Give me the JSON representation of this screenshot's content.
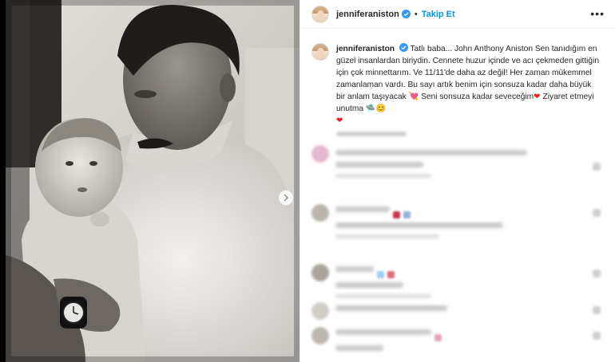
{
  "post": {
    "username": "jenniferaniston",
    "follow_label": "Takip Et",
    "separator": "•",
    "more_label": "•••",
    "caption": {
      "username": "jenniferaniston",
      "text_1": "Tatlı baba... John Anthony Aniston Sen tanıdığım en güzel insanlardan biriydin. Cennete huzur içinde ve acı çekmeden gittiğin için çok minnettarım. Ve 11/11'de daha az değil! Her zaman mükemmel zamanlaman vardı. Bu sayı artık benim için sonsuza kadar daha büyük bir anlam taşıyacak ",
      "emoji_1": "💘",
      "text_2": " Seni sonsuza kadar seveceğim",
      "emoji_2": "❤",
      "text_3": " Ziyaret etmeyi unutma ",
      "emoji_3": "🛸",
      "emoji_4": "😊",
      "emoji_5": "❤"
    }
  },
  "photo": {
    "description_icon": "next-arrow-icon"
  },
  "colors": {
    "accent": "#0095f6",
    "verified": "#3897f0",
    "heart": "#ed1c24",
    "text": "#262626",
    "divider": "#efefef"
  }
}
